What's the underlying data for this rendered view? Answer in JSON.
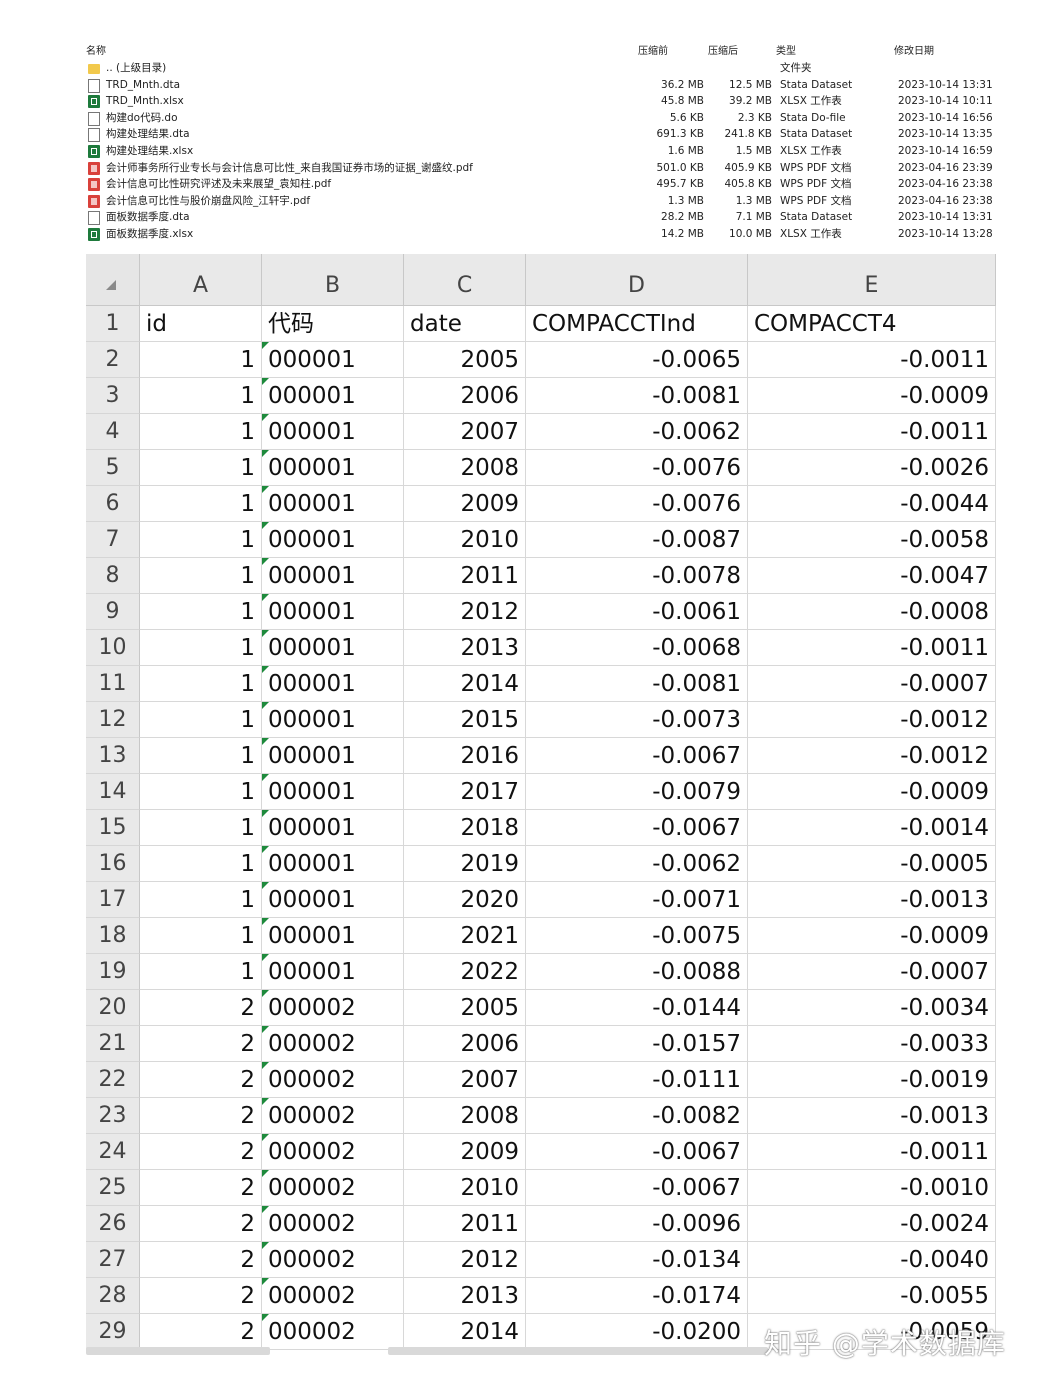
{
  "explorer": {
    "headers": {
      "name": "名称",
      "packed": "压缩前",
      "original": "压缩后",
      "type": "类型",
      "modified": "修改日期"
    },
    "files": [
      {
        "icon": "folder-icon",
        "kind": "folder",
        "name": ".. (上级目录)",
        "packed": "",
        "original": "",
        "type": "文件夹",
        "modified": ""
      },
      {
        "icon": "file-icon",
        "kind": "doc",
        "name": "TRD_Mnth.dta",
        "packed": "36.2 MB",
        "original": "12.5 MB",
        "type": "Stata Dataset",
        "modified": "2023-10-14 13:31"
      },
      {
        "icon": "excel-icon",
        "kind": "xlsx",
        "name": "TRD_Mnth.xlsx",
        "packed": "45.8 MB",
        "original": "39.2 MB",
        "type": "XLSX 工作表",
        "modified": "2023-10-14 10:11"
      },
      {
        "icon": "file-icon",
        "kind": "doc",
        "name": "构建do代码.do",
        "packed": "5.6 KB",
        "original": "2.3 KB",
        "type": "Stata Do-file",
        "modified": "2023-10-14 16:56"
      },
      {
        "icon": "file-icon",
        "kind": "doc",
        "name": "构建处理结果.dta",
        "packed": "691.3 KB",
        "original": "241.8 KB",
        "type": "Stata Dataset",
        "modified": "2023-10-14 13:35"
      },
      {
        "icon": "excel-icon",
        "kind": "xlsx",
        "name": "构建处理结果.xlsx",
        "packed": "1.6 MB",
        "original": "1.5 MB",
        "type": "XLSX 工作表",
        "modified": "2023-10-14 16:59"
      },
      {
        "icon": "pdf-icon",
        "kind": "pdf",
        "name": "会计师事务所行业专长与会计信息可比性_来自我国证券市场的证据_谢盛纹.pdf",
        "packed": "501.0 KB",
        "original": "405.9 KB",
        "type": "WPS PDF 文档",
        "modified": "2023-04-16 23:39"
      },
      {
        "icon": "pdf-icon",
        "kind": "pdf",
        "name": "会计信息可比性研究评述及未来展望_袁知柱.pdf",
        "packed": "495.7 KB",
        "original": "405.8 KB",
        "type": "WPS PDF 文档",
        "modified": "2023-04-16 23:38"
      },
      {
        "icon": "pdf-icon",
        "kind": "pdf",
        "name": "会计信息可比性与股价崩盘风险_江轩宇.pdf",
        "packed": "1.3 MB",
        "original": "1.3 MB",
        "type": "WPS PDF 文档",
        "modified": "2023-04-16 23:38"
      },
      {
        "icon": "file-icon",
        "kind": "doc",
        "name": "面板数据季度.dta",
        "packed": "28.2 MB",
        "original": "7.1 MB",
        "type": "Stata Dataset",
        "modified": "2023-10-14 13:31"
      },
      {
        "icon": "excel-icon",
        "kind": "xlsx",
        "name": "面板数据季度.xlsx",
        "packed": "14.2 MB",
        "original": "10.0 MB",
        "type": "XLSX 工作表",
        "modified": "2023-10-14 13:28"
      }
    ]
  },
  "sheet": {
    "columns": [
      "A",
      "B",
      "C",
      "D",
      "E"
    ],
    "header_row": {
      "number": "1",
      "cells": [
        "id",
        "代码",
        "date",
        "COMPACCTInd",
        "COMPACCT4"
      ]
    },
    "rows": [
      {
        "n": "2",
        "id": "1",
        "code": "000001",
        "date": "2005",
        "ind": "-0.0065",
        "c4": "-0.0011"
      },
      {
        "n": "3",
        "id": "1",
        "code": "000001",
        "date": "2006",
        "ind": "-0.0081",
        "c4": "-0.0009"
      },
      {
        "n": "4",
        "id": "1",
        "code": "000001",
        "date": "2007",
        "ind": "-0.0062",
        "c4": "-0.0011"
      },
      {
        "n": "5",
        "id": "1",
        "code": "000001",
        "date": "2008",
        "ind": "-0.0076",
        "c4": "-0.0026"
      },
      {
        "n": "6",
        "id": "1",
        "code": "000001",
        "date": "2009",
        "ind": "-0.0076",
        "c4": "-0.0044"
      },
      {
        "n": "7",
        "id": "1",
        "code": "000001",
        "date": "2010",
        "ind": "-0.0087",
        "c4": "-0.0058"
      },
      {
        "n": "8",
        "id": "1",
        "code": "000001",
        "date": "2011",
        "ind": "-0.0078",
        "c4": "-0.0047"
      },
      {
        "n": "9",
        "id": "1",
        "code": "000001",
        "date": "2012",
        "ind": "-0.0061",
        "c4": "-0.0008"
      },
      {
        "n": "10",
        "id": "1",
        "code": "000001",
        "date": "2013",
        "ind": "-0.0068",
        "c4": "-0.0011"
      },
      {
        "n": "11",
        "id": "1",
        "code": "000001",
        "date": "2014",
        "ind": "-0.0081",
        "c4": "-0.0007"
      },
      {
        "n": "12",
        "id": "1",
        "code": "000001",
        "date": "2015",
        "ind": "-0.0073",
        "c4": "-0.0012"
      },
      {
        "n": "13",
        "id": "1",
        "code": "000001",
        "date": "2016",
        "ind": "-0.0067",
        "c4": "-0.0012"
      },
      {
        "n": "14",
        "id": "1",
        "code": "000001",
        "date": "2017",
        "ind": "-0.0079",
        "c4": "-0.0009"
      },
      {
        "n": "15",
        "id": "1",
        "code": "000001",
        "date": "2018",
        "ind": "-0.0067",
        "c4": "-0.0014"
      },
      {
        "n": "16",
        "id": "1",
        "code": "000001",
        "date": "2019",
        "ind": "-0.0062",
        "c4": "-0.0005"
      },
      {
        "n": "17",
        "id": "1",
        "code": "000001",
        "date": "2020",
        "ind": "-0.0071",
        "c4": "-0.0013"
      },
      {
        "n": "18",
        "id": "1",
        "code": "000001",
        "date": "2021",
        "ind": "-0.0075",
        "c4": "-0.0009"
      },
      {
        "n": "19",
        "id": "1",
        "code": "000001",
        "date": "2022",
        "ind": "-0.0088",
        "c4": "-0.0007"
      },
      {
        "n": "20",
        "id": "2",
        "code": "000002",
        "date": "2005",
        "ind": "-0.0144",
        "c4": "-0.0034"
      },
      {
        "n": "21",
        "id": "2",
        "code": "000002",
        "date": "2006",
        "ind": "-0.0157",
        "c4": "-0.0033"
      },
      {
        "n": "22",
        "id": "2",
        "code": "000002",
        "date": "2007",
        "ind": "-0.0111",
        "c4": "-0.0019"
      },
      {
        "n": "23",
        "id": "2",
        "code": "000002",
        "date": "2008",
        "ind": "-0.0082",
        "c4": "-0.0013"
      },
      {
        "n": "24",
        "id": "2",
        "code": "000002",
        "date": "2009",
        "ind": "-0.0067",
        "c4": "-0.0011"
      },
      {
        "n": "25",
        "id": "2",
        "code": "000002",
        "date": "2010",
        "ind": "-0.0067",
        "c4": "-0.0010"
      },
      {
        "n": "26",
        "id": "2",
        "code": "000002",
        "date": "2011",
        "ind": "-0.0096",
        "c4": "-0.0024"
      },
      {
        "n": "27",
        "id": "2",
        "code": "000002",
        "date": "2012",
        "ind": "-0.0134",
        "c4": "-0.0040"
      },
      {
        "n": "28",
        "id": "2",
        "code": "000002",
        "date": "2013",
        "ind": "-0.0174",
        "c4": "-0.0055"
      },
      {
        "n": "29",
        "id": "2",
        "code": "000002",
        "date": "2014",
        "ind": "-0.0200",
        "c4": "-0.0059"
      }
    ],
    "text_indicator_color": "#1e8a3c"
  },
  "watermark": {
    "text": "知乎 @学术数据库"
  }
}
